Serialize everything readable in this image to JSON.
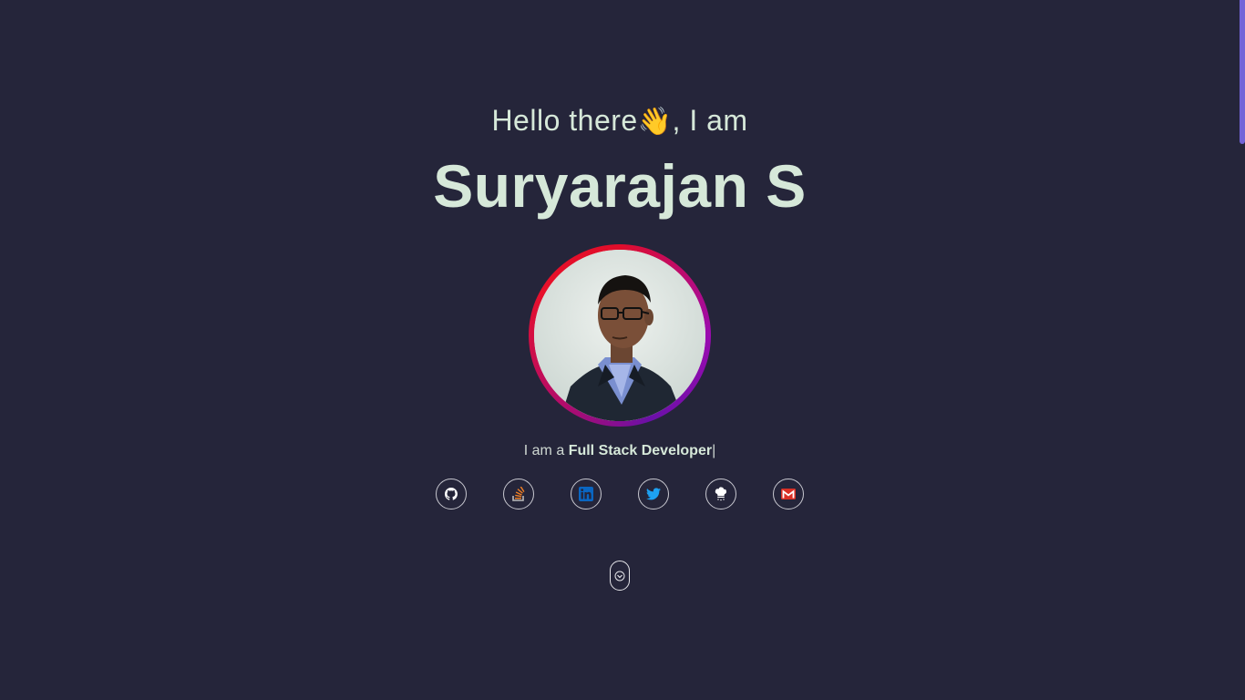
{
  "hero": {
    "greeting_before": "Hello there",
    "greeting_wave": "👋",
    "greeting_after": ", I am",
    "name": "Suryarajan S",
    "tagline_prefix": "I am a",
    "tagline_role": "Full Stack Developer",
    "cursor": "|"
  },
  "avatar": {
    "ring_colors": [
      "#e00d2a",
      "#9a0bb0",
      "#6a10a8"
    ]
  },
  "socials": [
    {
      "name": "github",
      "icon": "github-icon",
      "color": "#ffffff"
    },
    {
      "name": "stackoverflow",
      "icon": "stackoverflow-icon",
      "color": "#f48024"
    },
    {
      "name": "linkedin",
      "icon": "linkedin-icon",
      "color": "#0a66c2"
    },
    {
      "name": "twitter",
      "icon": "twitter-icon",
      "color": "#1da1f2"
    },
    {
      "name": "kaggle",
      "icon": "chef-hat-icon",
      "color": "#ffffff"
    },
    {
      "name": "gmail",
      "icon": "gmail-icon",
      "color": "#d93025"
    }
  ],
  "scroll_hint": {
    "icon": "chevron-down-icon"
  },
  "colors": {
    "background": "#25253a",
    "text": "#d6e8d9",
    "accent_scrollbar": "#7264d8"
  }
}
